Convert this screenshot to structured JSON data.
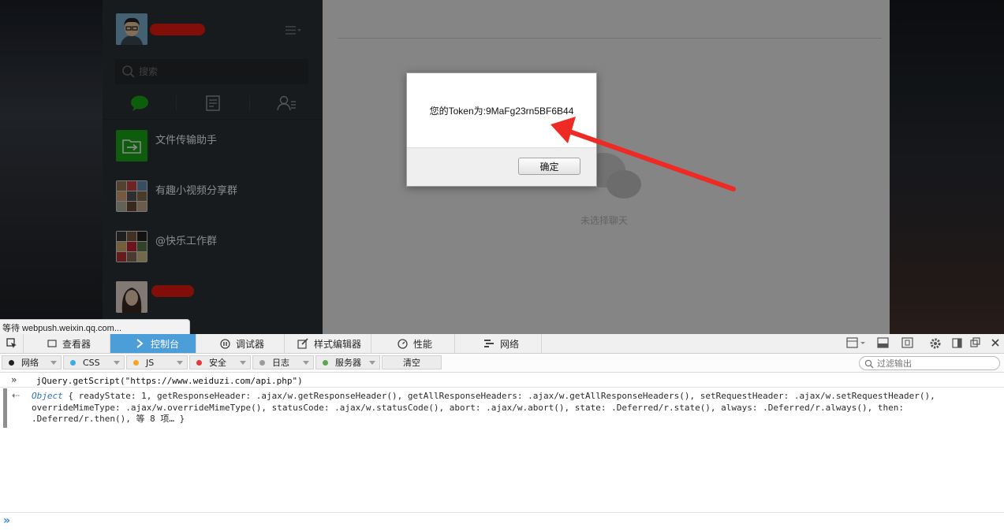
{
  "app": {
    "search_placeholder": "搜索",
    "chats": [
      {
        "name": "文件传输助手"
      },
      {
        "name": "有趣小视频分享群"
      },
      {
        "name": "@快乐工作群"
      }
    ],
    "empty_text": "未选择聊天"
  },
  "dialog": {
    "message": "您的Token为:9MaFg23rn5BF6B44",
    "ok_label": "确定"
  },
  "status_bar": {
    "text": "等待 webpush.weixin.qq.com..."
  },
  "devtools": {
    "tabs": [
      {
        "label": "查看器",
        "icon": "inspector-icon"
      },
      {
        "label": "控制台",
        "icon": "console-icon"
      },
      {
        "label": "调试器",
        "icon": "debugger-icon"
      },
      {
        "label": "样式编辑器",
        "icon": "style-editor-icon"
      },
      {
        "label": "性能",
        "icon": "performance-icon"
      },
      {
        "label": "网络",
        "icon": "network-icon"
      }
    ],
    "active_tab": "控制台",
    "filters": [
      {
        "label": "网络",
        "color": "#222222"
      },
      {
        "label": "CSS",
        "color": "#3fa9e8"
      },
      {
        "label": "JS",
        "color": "#f5a623"
      },
      {
        "label": "安全",
        "color": "#e3383b"
      },
      {
        "label": "日志",
        "color": "#9b9b9b"
      },
      {
        "label": "服务器",
        "color": "#5aa84d"
      }
    ],
    "clear_label": "清空",
    "filter_placeholder": "过滤输出",
    "command": "jQuery.getScript(\"https://www.weiduzi.com/api.php\")",
    "result": {
      "prefix": "Object",
      "line1": "{ readyState: 1, getResponseHeader: .ajax/w.getResponseHeader(), getAllResponseHeaders: .ajax/w.getAllResponseHeaders(), setRequestHeader: .ajax/w.setRequestHeader(),",
      "line2": "overrideMimeType: .ajax/w.overrideMimeType(), statusCode: .ajax/w.statusCode(), abort: .ajax/w.abort(), state: .Deferred/r.state(), always: .Deferred/r.always(), then:",
      "line3": ".Deferred/r.then(), 等 8 项… }"
    }
  },
  "colors": {
    "accent": "#4c9ed9",
    "annotation_arrow": "#ee2a24",
    "wechat_green": "#1aad19"
  }
}
